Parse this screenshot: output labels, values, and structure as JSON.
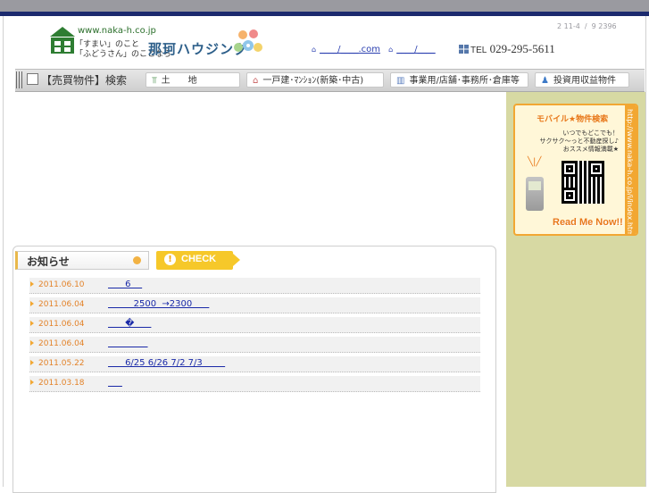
{
  "header": {
    "url": "www.naka-h.co.jp",
    "tagline_line1": "「すまい」のこと",
    "tagline_line2": "「ふどうさん」のことなら",
    "company_name": "那珂ハウジング",
    "address": "2 11-4  /  9 2396",
    "mail_link_1": "____/____.com",
    "mail_link_2": "____/____",
    "tel_label": "TEL",
    "tel_number": "029-295-5611"
  },
  "nav": {
    "title": "【売買物件】検索",
    "items": [
      {
        "label": "土　　地",
        "icon": "tree-icon"
      },
      {
        "label": "一戸建･ﾏﾝｼｮﾝ(新築･中古)",
        "icon": "house-icon"
      },
      {
        "label": "事業用/店舗･事務所･倉庫等",
        "icon": "building-icon"
      },
      {
        "label": "投資用収益物件",
        "icon": "person-icon"
      }
    ]
  },
  "sidebar": {
    "mobile_title": "モバイル★物件検索",
    "mobile_text1": "いつでもどこでも！",
    "mobile_text2": "サクサク〜っと不動産探し♪",
    "mobile_text3": "おススメ情報満載★",
    "mobile_url": "http://www.naka-h.co.jp/i/index.html",
    "readme": "Read Me Now!!"
  },
  "news": {
    "title": "お知らせ",
    "check_label": "CHECK",
    "items": [
      {
        "date": "2011.06.10",
        "text": "      6    "
      },
      {
        "date": "2011.06.04",
        "text": "         2500  →2300      "
      },
      {
        "date": "2011.06.04",
        "text": "      �      "
      },
      {
        "date": "2011.06.04",
        "text": "              "
      },
      {
        "date": "2011.05.22",
        "text": "      6/25 6/26 7/2 7/3        "
      },
      {
        "date": "2011.03.18",
        "text": "     "
      }
    ]
  },
  "colors": {
    "navy": "#1c2a6e",
    "accent_orange": "#f2a732",
    "sidebar_green": "#d7d9a3",
    "link_blue": "#1a2aa8"
  }
}
